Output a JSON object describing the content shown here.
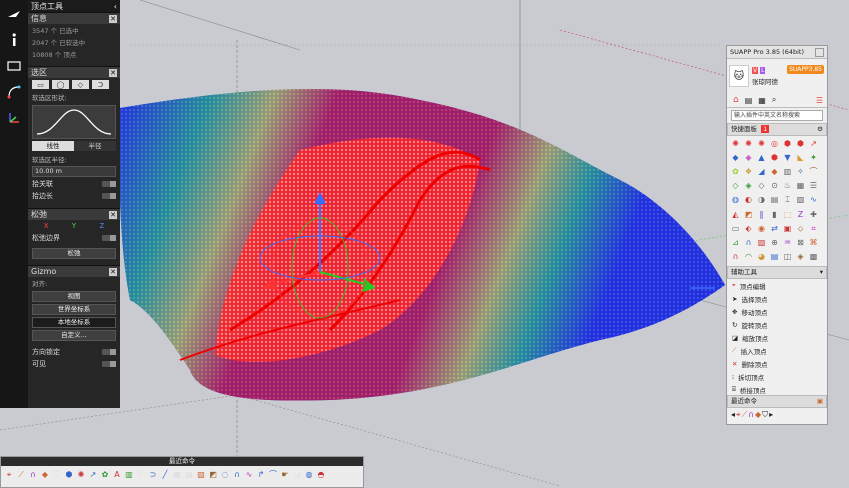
{
  "colors": {
    "viewport_bg": "#c9cbd0",
    "mesh_blue": "#1f2fe0",
    "mesh_red": "#ff1010",
    "mesh_green": "#29d16a",
    "mesh_yellow": "#f2ee28",
    "panel_dark": "#262626",
    "suapp_orange": "#f08a1c"
  },
  "vertex_panel": {
    "title": "顶点工具",
    "info": {
      "title": "信息",
      "lines": [
        "3547 个 已选中",
        "2047 个 已软选中",
        "10808 个 顶点"
      ]
    },
    "selection": {
      "title": "选区",
      "soft_shape_label": "软选区形状:",
      "modes": [
        "线性",
        "半径"
      ],
      "radius_label": "软选区半径:",
      "radius_value": "10.00 m",
      "toggles": [
        "拾关联",
        "拾边长"
      ]
    },
    "relax": {
      "title": "松弛",
      "axes": [
        "X",
        "Y",
        "Z"
      ],
      "boundary_label": "松弛边界",
      "button": "松弛"
    },
    "gizmo": {
      "title": "Gizmo",
      "align_label": "对齐:",
      "buttons": [
        "视图",
        "世界坐标系",
        "本地坐标系",
        "自定义..."
      ],
      "toggles": [
        "方向锁定",
        "可见"
      ]
    }
  },
  "suapp": {
    "title": "SUAPP Pro 3.85 (64bit)",
    "badge": "SUAPP3.85",
    "user": "张琼阿德",
    "search_placeholder": "输入插件中英文名称搜索",
    "quick_panel": {
      "title": "快捷面板",
      "count": "1"
    },
    "aux_tools": {
      "title": "辅助工具",
      "items": [
        "顶点编辑",
        "选择顶点",
        "移动顶点",
        "旋转顶点",
        "缩放顶点",
        "插入顶点",
        "删除顶点",
        "拆切顶点",
        "桥接顶点"
      ]
    },
    "recent": {
      "title": "最近命令"
    }
  },
  "recent_toolbar": {
    "title": "最近命令"
  }
}
